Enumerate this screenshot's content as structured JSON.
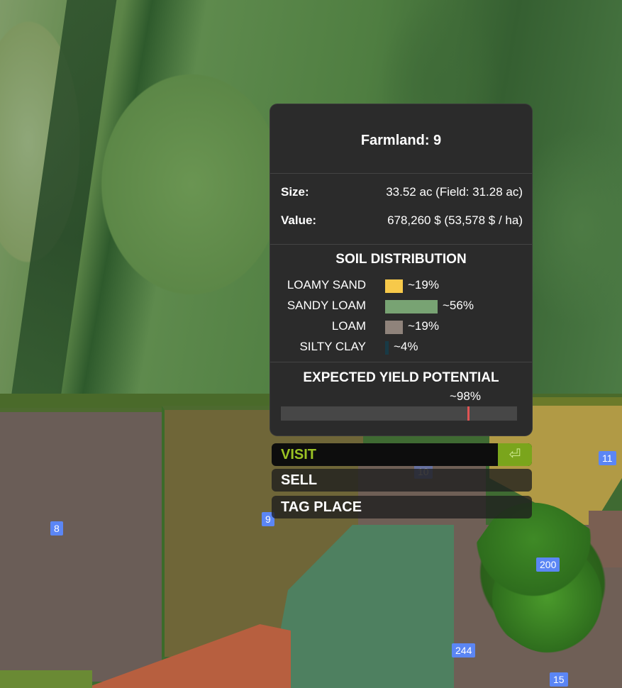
{
  "popup": {
    "title": "Farmland: 9",
    "size_label": "Size:",
    "size_value": "33.52 ac (Field: 31.28 ac)",
    "value_label": "Value:",
    "value_value": "678,260 $ (53,578 $ / ha)",
    "soil_heading": "SOIL DISTRIBUTION",
    "soils": [
      {
        "name": "LOAMY SAND",
        "percent_text": "~19%",
        "share": 0.19,
        "color": "#f7c94a"
      },
      {
        "name": "SANDY LOAM",
        "percent_text": "~56%",
        "share": 0.56,
        "color": "#78a373"
      },
      {
        "name": "LOAM",
        "percent_text": "~19%",
        "share": 0.19,
        "color": "#8f837b"
      },
      {
        "name": "SILTY CLAY",
        "percent_text": "~4%",
        "share": 0.04,
        "color": "#183a46"
      }
    ],
    "yield_heading": "EXPECTED YIELD POTENTIAL",
    "yield_text": "~98%",
    "yield_fraction": 0.79
  },
  "menu": {
    "visit": "VISIT",
    "sell": "SELL",
    "tag_place": "TAG PLACE",
    "enter_icon": "⏎"
  },
  "map_labels": {
    "f8": "8",
    "f9": "9",
    "f10": "10",
    "f11": "11",
    "f200": "200",
    "f244": "244",
    "f15": "15"
  },
  "colors": {
    "accent": "#9bc224",
    "yield_marker": "#e05454",
    "farm_label": "#5b86f5"
  }
}
